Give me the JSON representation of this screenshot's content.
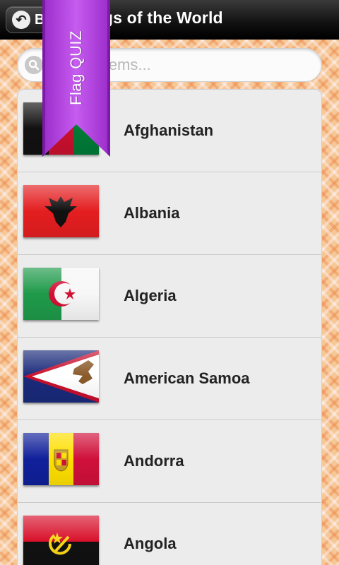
{
  "header": {
    "back_label": "Back",
    "title": "Flags of the World"
  },
  "search": {
    "placeholder": "Search items..."
  },
  "ribbon": {
    "label": "Flag QUIZ"
  },
  "countries": [
    {
      "name": "Afghanistan",
      "flag_icon": "afghanistan-flag"
    },
    {
      "name": "Albania",
      "flag_icon": "albania-flag"
    },
    {
      "name": "Algeria",
      "flag_icon": "algeria-flag"
    },
    {
      "name": "American Samoa",
      "flag_icon": "american-samoa-flag"
    },
    {
      "name": "Andorra",
      "flag_icon": "andorra-flag"
    },
    {
      "name": "Angola",
      "flag_icon": "angola-flag"
    }
  ],
  "colors": {
    "ribbon": "#b83ee0",
    "topbar": "#111111"
  }
}
